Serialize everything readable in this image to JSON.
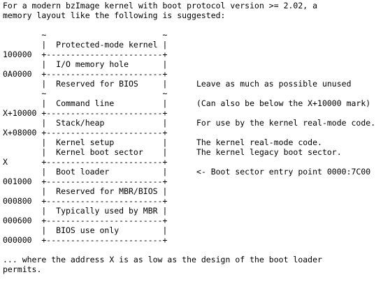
{
  "document": {
    "lines": [
      "For a modern bzImage kernel with boot protocol version >= 2.02, a",
      "memory layout like the following is suggested:",
      "",
      "        ~                        ~",
      "        |  Protected-mode kernel |",
      "100000  +------------------------+",
      "        |  I/O memory hole       |",
      "0A0000  +------------------------+",
      "        |  Reserved for BIOS     |      Leave as much as possible unused",
      "        ~                        ~",
      "        |  Command line          |      (Can also be below the X+10000 mark)",
      "X+10000 +------------------------+",
      "        |  Stack/heap            |      For use by the kernel real-mode code.",
      "X+08000 +------------------------+",
      "        |  Kernel setup          |      The kernel real-mode code.",
      "        |  Kernel boot sector    |      The kernel legacy boot sector.",
      "X       +------------------------+",
      "        |  Boot loader           |      <- Boot sector entry point 0000:7C00",
      "001000  +------------------------+",
      "        |  Reserved for MBR/BIOS |",
      "000800  +------------------------+",
      "        |  Typically used by MBR |",
      "000600  +------------------------+",
      "        |  BIOS use only         |",
      "000000  +------------------------+",
      "",
      "... where the address X is as low as the design of the boot loader",
      "permits."
    ]
  }
}
